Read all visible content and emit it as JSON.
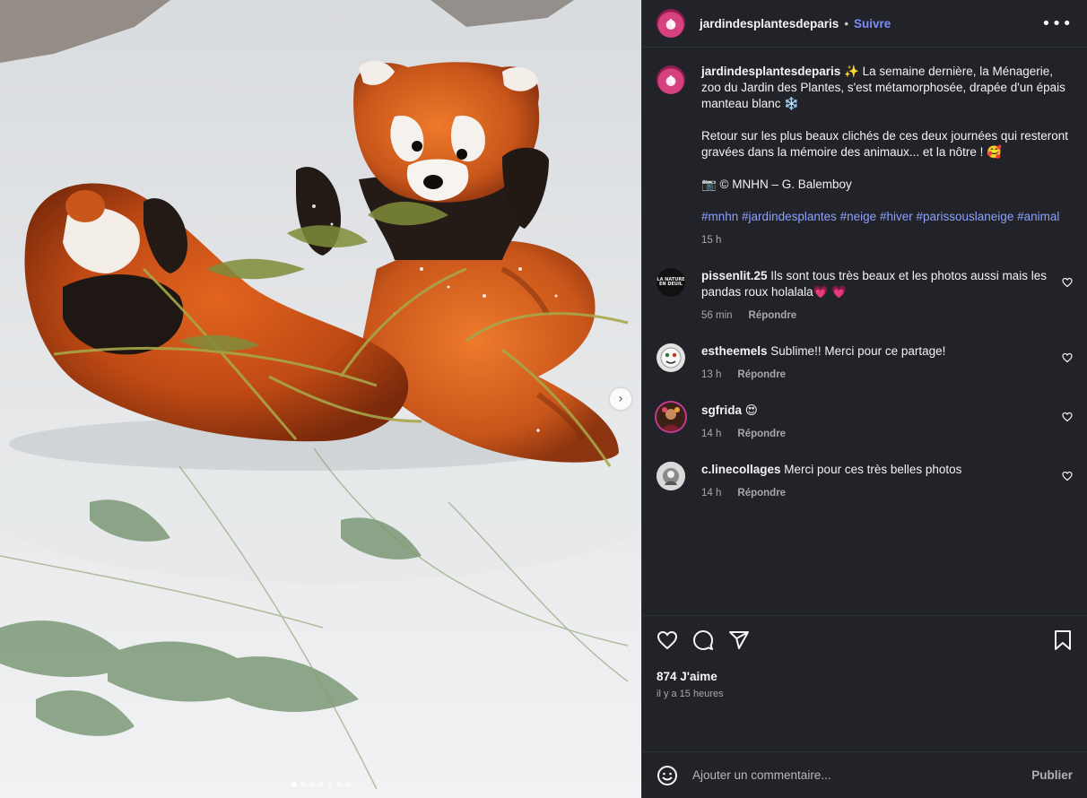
{
  "post": {
    "account": "jardindesplantesdeparis",
    "separator": "•",
    "follow_label": "Suivre",
    "more_label": "•••"
  },
  "caption": {
    "username": "jardindesplantesdeparis",
    "line1": " ✨ La semaine dernière, la Ménagerie, zoo du Jardin des Plantes, s'est métamorphosée, drapée d'un épais manteau blanc ❄️",
    "line2": "Retour sur les plus beaux clichés de ces deux journées qui resteront gravées dans la mémoire des animaux... et la nôtre ! 🥰",
    "line3": "📷 © MNHN – G. Balemboy",
    "hashtags": [
      "#mnhn",
      "#jardindesplantes",
      "#neige",
      "#hiver",
      "#parissouslaneige",
      "#animal"
    ],
    "time": "15 h"
  },
  "comments": [
    {
      "username": "pissenlit.25",
      "text": " Ils sont tous très beaux et les photos aussi mais les pandas roux holalala💗 💗",
      "time": "56 min",
      "reply": "Répondre",
      "avatar_text": "LA NATURE EN DEUIL"
    },
    {
      "username": "estheemels",
      "text": " Sublime!! Merci pour ce partage!",
      "time": "13 h",
      "reply": "Répondre"
    },
    {
      "username": "sgfrida",
      "text": " 😍",
      "time": "14 h",
      "reply": "Répondre"
    },
    {
      "username": "c.linecollages",
      "text": " Merci pour ces très belles photos",
      "time": "14 h",
      "reply": "Répondre"
    }
  ],
  "actions": {
    "likes": "874 J'aime",
    "posted": "il y a 15 heures"
  },
  "composer": {
    "placeholder": "Ajouter un commentaire...",
    "publish_label": "Publier"
  },
  "media": {
    "next_glyph": "›",
    "slides": 7,
    "active_slide": 1
  },
  "colors": {
    "panel_bg": "#212328",
    "link": "#7c8cff",
    "hashtag": "#8da0ff",
    "muted": "#a8a8a8"
  }
}
